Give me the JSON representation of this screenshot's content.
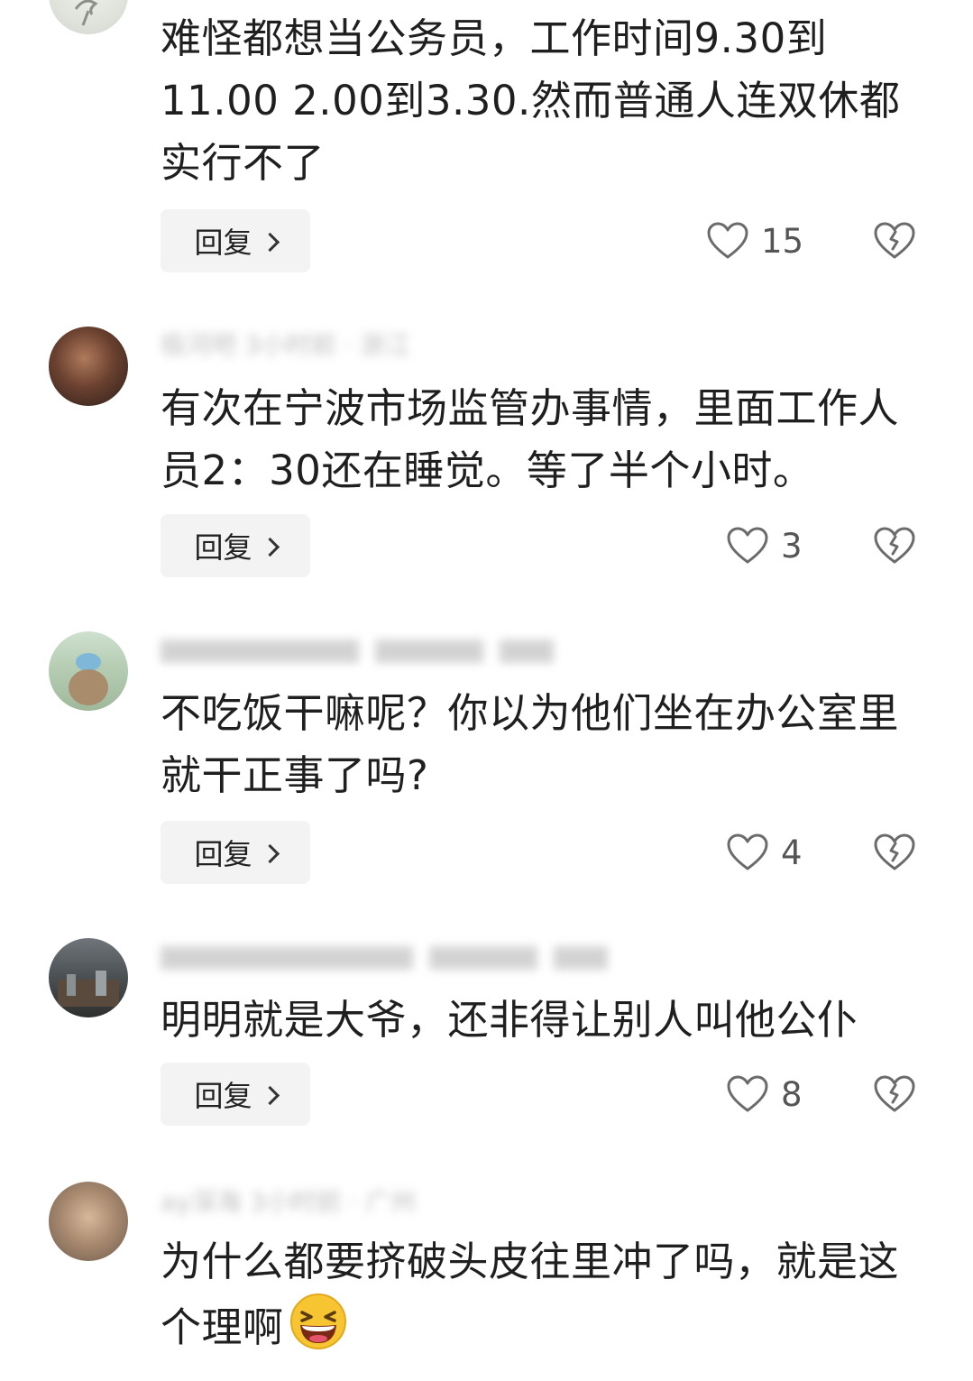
{
  "reply_label": "回复",
  "comments": [
    {
      "text": "难怪都想当公务员，工作时间9.30到11.00 2.00到3.30.然而普通人连双休都实行不了",
      "likes": "15"
    },
    {
      "meta": "极河吧  3小时前 · 浙江",
      "text": "有次在宁波市场监管办事情，里面工作人员2：30还在睡觉。等了半个小时。",
      "likes": "3"
    },
    {
      "text": "不吃饭干嘛呢？你以为他们坐在办公室里就干正事了吗?",
      "likes": "4"
    },
    {
      "text": "明明就是大爷，还非得让别人叫他公仆",
      "likes": "8"
    },
    {
      "meta": "ay深海  3小时前 · 广州",
      "text": "为什么都要挤破头皮往里冲了吗，就是这个理啊"
    }
  ],
  "icons": {
    "like": "heart-outline-icon",
    "dislike": "broken-heart-icon",
    "reply_arrow": "chevron-right-icon",
    "emoji": "grinning-squinting-face-emoji"
  },
  "colors": {
    "text": "#1f1f1f",
    "button_bg": "#f3f3f3",
    "icon": "#6b6b6b",
    "emoji_face": "#f7c531"
  }
}
